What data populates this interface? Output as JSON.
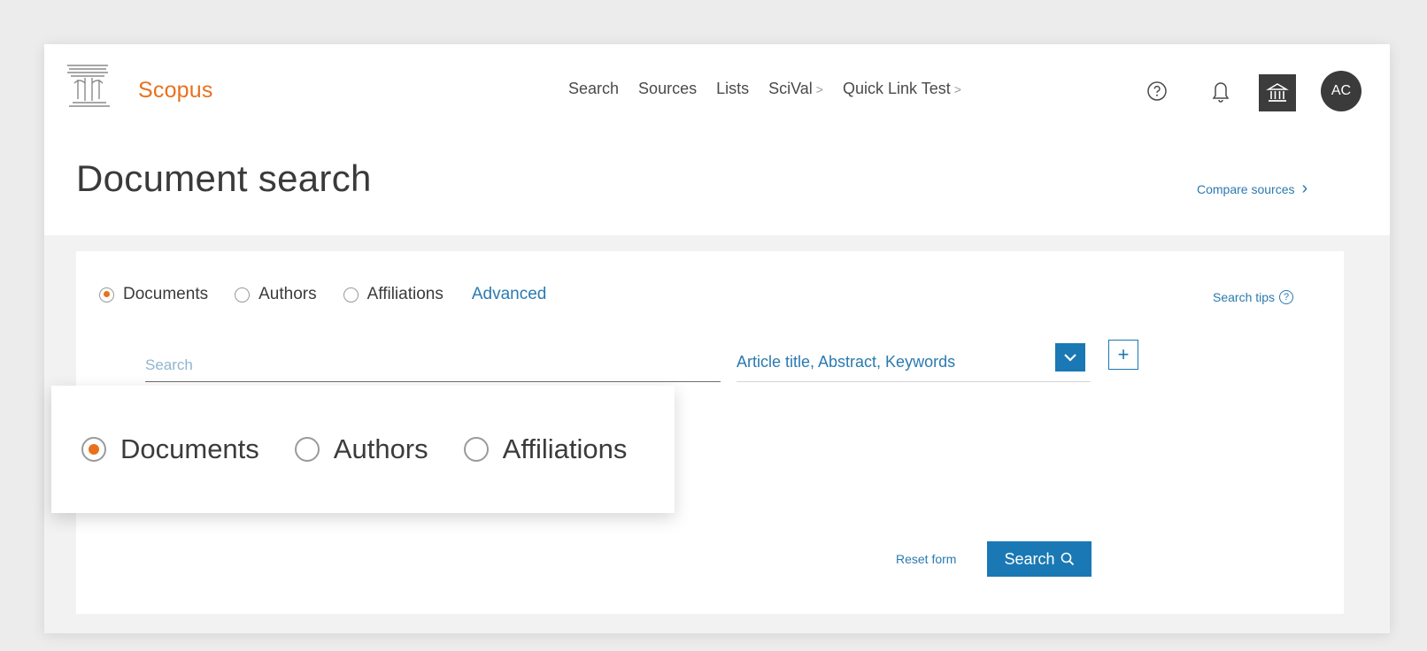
{
  "app": {
    "brand": "Scopus"
  },
  "nav": {
    "items": [
      {
        "label": "Search"
      },
      {
        "label": "Sources"
      },
      {
        "label": "Lists"
      },
      {
        "label": "SciVal",
        "external": ">"
      },
      {
        "label": "Quick Link Test",
        "external": ">"
      }
    ]
  },
  "header": {
    "avatar_initials": "AC"
  },
  "page": {
    "title": "Document search",
    "compare_link": "Compare sources",
    "compare_chevron": "›"
  },
  "search": {
    "types": [
      {
        "label": "Documents",
        "selected": true
      },
      {
        "label": "Authors",
        "selected": false
      },
      {
        "label": "Affiliations",
        "selected": false
      }
    ],
    "advanced_label": "Advanced",
    "tips_label": "Search tips",
    "tips_icon": "?",
    "input_placeholder": "Search",
    "field_value": "Article title, Abstract, Keywords",
    "add_label": "+",
    "reset_label": "Reset form",
    "submit_label": "Search"
  },
  "zoom": {
    "types": [
      {
        "label": "Documents",
        "selected": true
      },
      {
        "label": "Authors",
        "selected": false
      },
      {
        "label": "Affiliations",
        "selected": false
      }
    ]
  },
  "colors": {
    "brand": "#e9711c",
    "link": "#2a7ab0",
    "primary_button": "#1a78b4"
  },
  "icons": [
    "elsevier-logo-icon",
    "help-icon",
    "bell-icon",
    "institution-icon",
    "chevron-down-icon",
    "plus-icon",
    "search-icon"
  ]
}
